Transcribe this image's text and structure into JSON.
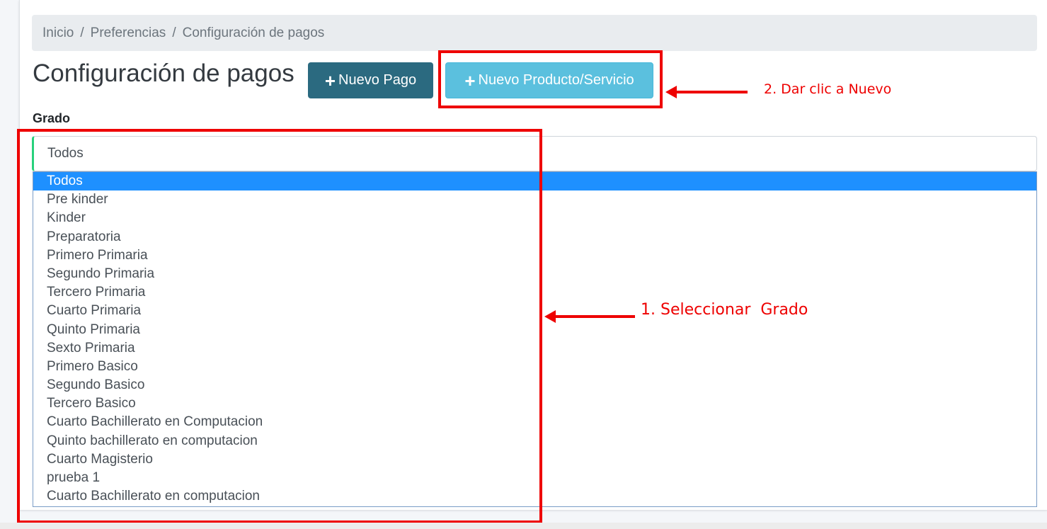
{
  "breadcrumb": {
    "items": [
      "Inicio",
      "Preferencias",
      "Configuración de pagos"
    ],
    "separator": "/"
  },
  "page": {
    "title": "Configuración de pagos"
  },
  "buttons": {
    "new_payment": "Nuevo Pago",
    "new_product": "Nuevo Producto/Servicio",
    "plus_icon": "+"
  },
  "grade_field": {
    "label": "Grado",
    "selected_value": "Todos",
    "options": [
      "Todos",
      "Pre kinder",
      "Kinder",
      "Preparatoria",
      "Primero Primaria",
      "Segundo Primaria",
      "Tercero Primaria",
      "Cuarto Primaria",
      "Quinto Primaria",
      "Sexto Primaria",
      "Primero Basico",
      "Segundo Basico",
      "Tercero Basico",
      "Cuarto Bachillerato en Computacion",
      "Quinto bachillerato en computacion",
      "Cuarto Magisterio",
      "prueba 1",
      "Cuarto Bachillerato en computacion"
    ]
  },
  "annotations": {
    "step1": "1. Seleccionar  Grado",
    "step2": "2. Dar clic a Nuevo"
  },
  "colors": {
    "accent_teal": "#17a2b8",
    "primary_button": "#2b6a80",
    "info_button": "#5bc0de",
    "selected_option": "#1e90ff",
    "annotation_red": "#ee0000"
  }
}
